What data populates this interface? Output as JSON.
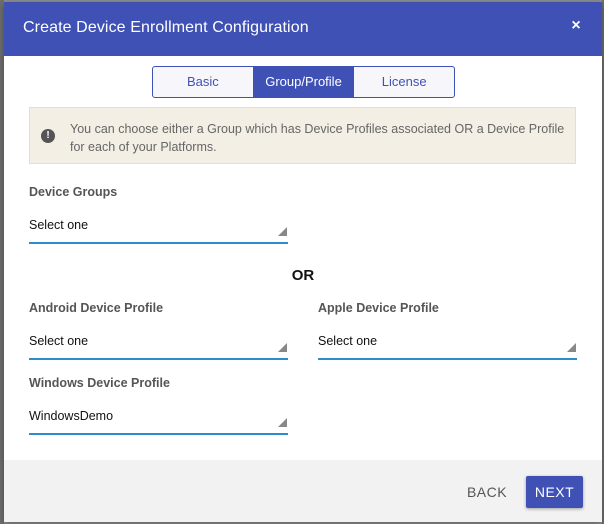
{
  "dialog": {
    "title": "Create Device Enrollment Configuration",
    "close_label": "×"
  },
  "tabs": [
    {
      "label": "Basic",
      "active": false
    },
    {
      "label": "Group/Profile",
      "active": true
    },
    {
      "label": "License",
      "active": false
    }
  ],
  "info": {
    "icon": "!",
    "message": "You can choose either a Group which has Device Profiles associated OR a Device Profile for each of your Platforms."
  },
  "device_groups": {
    "label": "Device Groups",
    "value": "Select one"
  },
  "or_text": "OR",
  "android_profile": {
    "label": "Android Device Profile",
    "value": "Select one"
  },
  "apple_profile": {
    "label": "Apple Device Profile",
    "value": "Select one"
  },
  "windows_profile": {
    "label": "Windows Device Profile",
    "value": "WindowsDemo"
  },
  "footer": {
    "back_label": "BACK",
    "next_label": "NEXT"
  },
  "colors": {
    "primary": "#3f51b5",
    "underline": "#2a8fc7",
    "info_bg": "#f3efe5"
  }
}
